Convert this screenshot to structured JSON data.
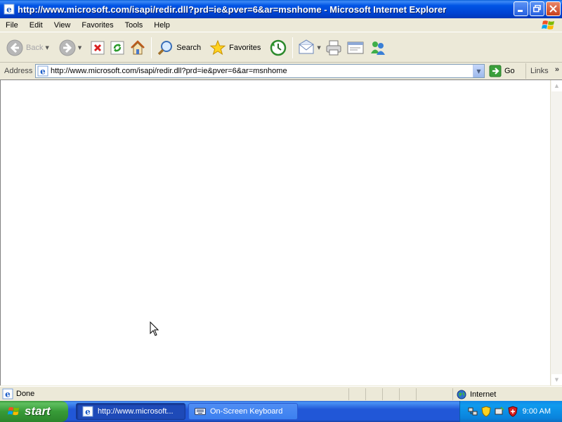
{
  "window": {
    "title": "http://www.microsoft.com/isapi/redir.dll?prd=ie&pver=6&ar=msnhome - Microsoft Internet Explorer",
    "icon": "ie-icon",
    "controls": [
      "minimize-icon",
      "restore-icon",
      "close-icon"
    ]
  },
  "menu": {
    "items": [
      "File",
      "Edit",
      "View",
      "Favorites",
      "Tools",
      "Help"
    ]
  },
  "toolbar": {
    "back": "Back",
    "search": "Search",
    "favorites": "Favorites"
  },
  "address": {
    "label": "Address",
    "url": "http://www.microsoft.com/isapi/redir.dll?prd=ie&pver=6&ar=msnhome",
    "go": "Go",
    "links": "Links",
    "more": "»"
  },
  "status": {
    "text": "Done",
    "zone": "Internet"
  },
  "taskbar": {
    "start": "start",
    "tasks": [
      {
        "label": "http://www.microsoft...",
        "active": true,
        "icon": "ie-icon"
      },
      {
        "label": "On-Screen Keyboard",
        "active": false,
        "icon": "keyboard-icon"
      }
    ],
    "clock": "9:00 AM",
    "tray_icons": [
      "network-icon",
      "security-shield-icon",
      "wireless-icon",
      "security-center-icon"
    ]
  },
  "colors": {
    "titlebar": "#0055e5",
    "taskbar": "#2157d7",
    "start": "#379b37",
    "chrome": "#ece9d8"
  }
}
